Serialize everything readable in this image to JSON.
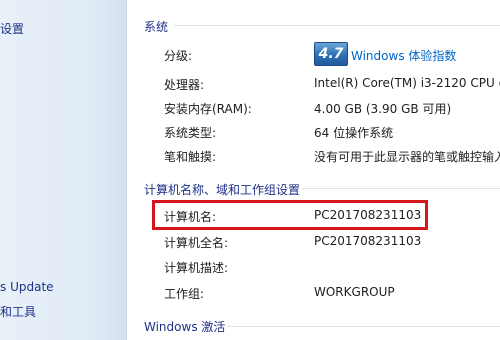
{
  "sidebar": {
    "links": [
      {
        "label": "设置"
      },
      {
        "label": "s Update"
      },
      {
        "label": "和工具"
      }
    ]
  },
  "system": {
    "section_title": "系统",
    "rating_label": "分级:",
    "rating_score": "4.7",
    "rating_link": "Windows 体验指数",
    "processor_label": "处理器:",
    "processor_value": "Intel(R) Core(TM) i3-2120 CPU @",
    "ram_label": "安装内存(RAM):",
    "ram_value": "4.00 GB (3.90 GB 可用)",
    "type_label": "系统类型:",
    "type_value": "64 位操作系统",
    "pen_label": "笔和触摸:",
    "pen_value": "没有可用于此显示器的笔或触控输入"
  },
  "computer": {
    "section_title": "计算机名称、域和工作组设置",
    "name_label": "计算机名:",
    "name_value": "PC201708231103",
    "fullname_label": "计算机全名:",
    "fullname_value": "PC201708231103",
    "desc_label": "计算机描述:",
    "desc_value": "",
    "workgroup_label": "工作组:",
    "workgroup_value": "WORKGROUP"
  },
  "activation": {
    "section_title": "Windows 激活"
  },
  "colors": {
    "highlight": "#d4161c",
    "link": "#0066cc",
    "section": "#1e3287"
  }
}
